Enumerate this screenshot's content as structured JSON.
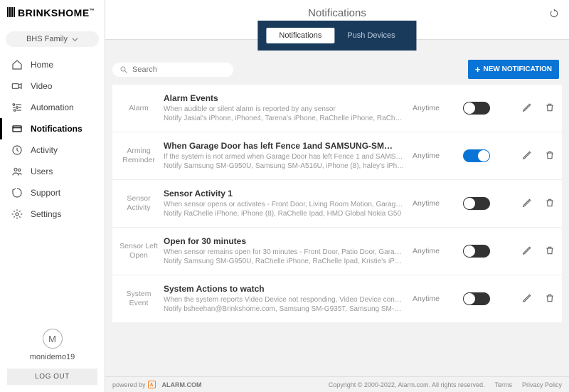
{
  "brand": "BRINKSHOME",
  "system_name": "BHS Family",
  "page_title": "Notifications",
  "tabs": [
    {
      "label": "Notifications",
      "active": true
    },
    {
      "label": "Push Devices",
      "active": false
    }
  ],
  "search_placeholder": "Search",
  "new_button": "NEW NOTIFICATION",
  "nav": [
    {
      "label": "Home",
      "icon": "home"
    },
    {
      "label": "Video",
      "icon": "video"
    },
    {
      "label": "Automation",
      "icon": "automation"
    },
    {
      "label": "Notifications",
      "icon": "notifications",
      "active": true
    },
    {
      "label": "Activity",
      "icon": "activity"
    },
    {
      "label": "Users",
      "icon": "users"
    },
    {
      "label": "Support",
      "icon": "support"
    },
    {
      "label": "Settings",
      "icon": "settings"
    }
  ],
  "avatar_letter": "M",
  "username": "monidemo19",
  "logout": "LOG OUT",
  "rows": [
    {
      "cat": "Alarm",
      "title": "Alarm Events",
      "bold": false,
      "desc": "When audible or silent alarm is reported by any sensor",
      "notify": "Notify Jasial's iPhone, iPhone4, Tarena's iPhone, RaChelle iPhone, RaChel…",
      "time": "Anytime",
      "on": false
    },
    {
      "cat": "Arming Reminder",
      "title": "When Garage Door has left Fence 1and SAMSUNG-SM…",
      "bold": true,
      "desc": "If the system is not armed when Garage Door has left Fence 1 and SAMSU…",
      "notify": "Notify Samsung SM-G950U, Samsung SM-A516U, iPhone (8), haley's iPh…",
      "time": "Anytime",
      "on": true
    },
    {
      "cat": "Sensor Activity",
      "title": "Sensor Activity 1",
      "bold": false,
      "desc": "When sensor opens or activates - Front Door, Living Room Motion, Garage …",
      "notify": "Notify RaChelle iPhone, iPhone (8), RaChelle Ipad, HMD Global Nokia G50",
      "time": "Anytime",
      "on": false
    },
    {
      "cat": "Sensor Left Open",
      "title": "Open for 30 minutes",
      "bold": false,
      "desc": "When sensor remains open for 30 minutes - Front Door, Patio Door, Garag…",
      "notify": "Notify Samsung SM-G950U, RaChelle iPhone, RaChelle Ipad, Kristie's iPh…",
      "time": "Anytime",
      "on": false
    },
    {
      "cat": "System Event",
      "title": "System Actions to watch",
      "bold": false,
      "desc": "When the system reports Video Device not responding, Video Device conn…",
      "notify": "Notify bsheehan@Brinkshome.com, Samsung SM-G935T, Samsung SM-G…",
      "time": "Anytime",
      "on": false
    }
  ],
  "footer": {
    "powered": "powered by",
    "alarm": "ALARM.COM",
    "copyright": "Copyright © 2000-2022, Alarm.com. All rights reserved.",
    "terms": "Terms",
    "privacy": "Privacy Policy"
  }
}
